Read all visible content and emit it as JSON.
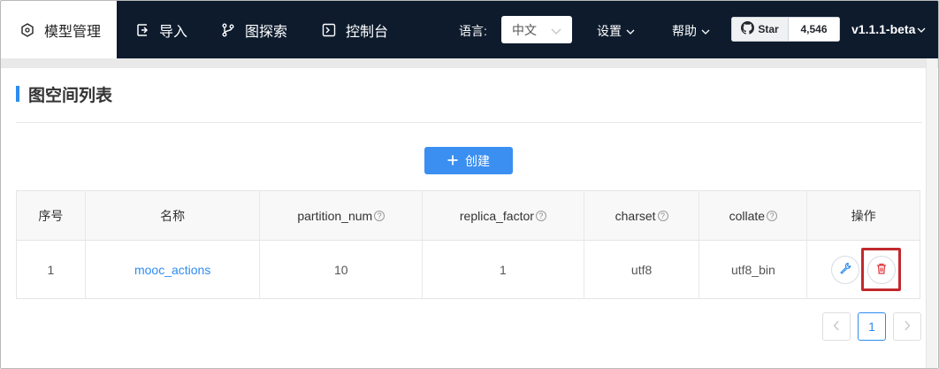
{
  "nav": {
    "items": [
      {
        "label": "模型管理",
        "icon": "model-icon",
        "active": true
      },
      {
        "label": "导入",
        "icon": "import-icon"
      },
      {
        "label": "图探索",
        "icon": "branch-icon"
      },
      {
        "label": "控制台",
        "icon": "console-icon"
      }
    ],
    "language_label": "语言:",
    "language_value": "中文",
    "settings_label": "设置",
    "help_label": "帮助",
    "github": {
      "star_label": "Star",
      "star_count": "4,546"
    },
    "version": "v1.1.1-beta"
  },
  "page": {
    "title": "图空间列表",
    "create_label": "创建"
  },
  "table": {
    "columns": [
      "序号",
      "名称",
      "partition_num",
      "replica_factor",
      "charset",
      "collate",
      "操作"
    ],
    "rows": [
      {
        "index": "1",
        "name": "mooc_actions",
        "partition_num": "10",
        "replica_factor": "1",
        "charset": "utf8",
        "collate": "utf8_bin"
      }
    ]
  },
  "pagination": {
    "current": "1"
  },
  "colors": {
    "nav_bg": "#0d1b2d",
    "accent": "#2d8cf0",
    "button": "#3b8ff0",
    "highlight": "#c1292e",
    "delete": "#e0343a"
  }
}
